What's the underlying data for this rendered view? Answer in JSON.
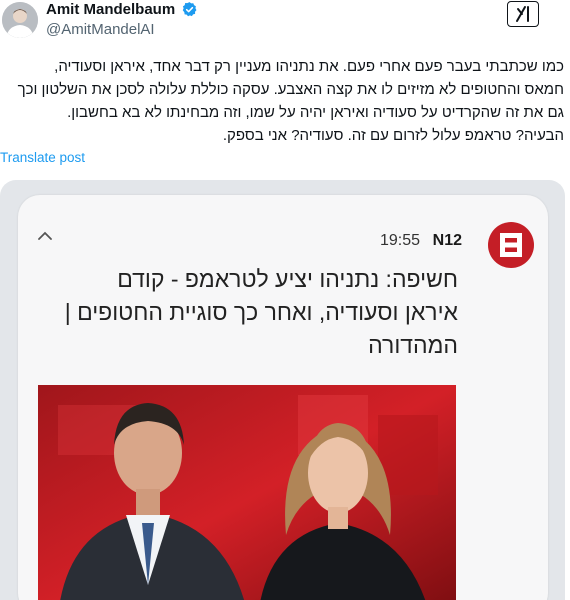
{
  "author": {
    "display_name": "Amit Mandelbaum",
    "handle": "@AmitMandelAI"
  },
  "post": {
    "lines": [
      "כמו שכתבתי בעבר פעם אחרי פעם. את נתניהו מעניין רק דבר אחד, איראן וסעודיה,",
      "חמאס והחטופים לא מזיזים לו את קצה האצבע. עסקה כוללת עלולה לסכן את השלטון וכך",
      "גם את זה שהקרדיט על סעודיה ואיראן יהיה על שמו, וזה מבחינתו לא בא בחשבון.",
      "הבעיה? טראמפ עלול לזרום עם זה. סעודיה? אני בספק."
    ],
    "translate_label": "Translate post"
  },
  "notification": {
    "source": "N12",
    "time": "19:55",
    "title_lines": [
      "חשיפה: נתניהו יציע לטראמפ - קודם",
      "איראן וסעודיה, ואחר כך סוגיית החטופים |",
      "המהדורה"
    ]
  },
  "icons": [
    "verified-badge-icon",
    "grok-icon",
    "n12-logo-icon",
    "chevron-up-icon",
    "avatar",
    "news-anchors-photo"
  ],
  "colors": {
    "link": "#1d9bf0",
    "verified": "#1d9bf0",
    "n12_red": "#c41e26",
    "text": "#0f1419",
    "secondary": "#536471"
  }
}
